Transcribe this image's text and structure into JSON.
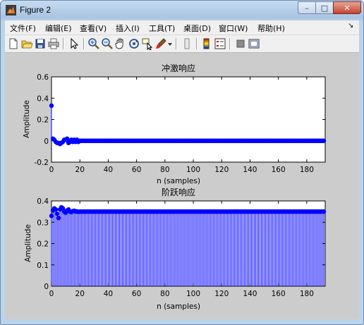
{
  "window": {
    "title": "Figure 2",
    "minimize_glyph": "–",
    "maximize_glyph": "□",
    "close_glyph": "✕"
  },
  "menubar": {
    "items": [
      "文件(F)",
      "编辑(E)",
      "查看(V)",
      "插入(I)",
      "工具(T)",
      "桌面(D)",
      "窗口(W)",
      "帮助(H)"
    ],
    "overflow_glyph": "↘"
  },
  "toolbar": {
    "buttons": [
      "new-figure-icon",
      "open-file-icon",
      "save-icon",
      "print-icon",
      "edit-plot-arrow-icon",
      "zoom-in-icon",
      "zoom-out-icon",
      "pan-hand-icon",
      "rotate-3d-icon",
      "data-cursor-icon",
      "brush-icon",
      "brush-dropdown-icon",
      "link-plot-icon",
      "insert-colorbar-icon",
      "insert-legend-icon",
      "hide-plot-tools-icon",
      "show-plot-tools-icon"
    ]
  },
  "colors": {
    "stem": "#0000ff",
    "axes_bg": "#ffffff",
    "figure_bg": "#cccccc"
  },
  "chart_data": [
    {
      "type": "scatter",
      "style": "stem",
      "title": "冲激响应",
      "xlabel": "n (samples)",
      "ylabel": "Amplitude",
      "xlim": [
        0,
        193
      ],
      "ylim": [
        -0.2,
        0.6
      ],
      "xticks": [
        0,
        20,
        40,
        60,
        80,
        100,
        120,
        140,
        160,
        180
      ],
      "yticks": [
        -0.2,
        0,
        0.2,
        0.4,
        0.6
      ],
      "xtick_labels": [
        "0",
        "20",
        "40",
        "60",
        "80",
        "100",
        "120",
        "140",
        "160",
        "180"
      ],
      "ytick_labels": [
        "-0.2",
        "0",
        "0.2",
        "0.4",
        "0.6"
      ],
      "grid": false,
      "n_points": 193,
      "head_values": [
        0.33,
        0.02,
        0.01,
        -0.01,
        -0.02,
        -0.02,
        -0.03,
        -0.02,
        -0.01,
        0.01,
        0.01,
        0.02,
        -0.02,
        -0.01,
        0.01,
        -0.01,
        0.01,
        -0.01,
        0.01,
        -0.01
      ],
      "tail_value": 0.0
    },
    {
      "type": "scatter",
      "style": "stem",
      "title": "阶跃响应",
      "xlabel": "n (samples)",
      "ylabel": "Amplitude",
      "xlim": [
        0,
        193
      ],
      "ylim": [
        0,
        0.4
      ],
      "xticks": [
        0,
        20,
        40,
        60,
        80,
        100,
        120,
        140,
        160,
        180
      ],
      "yticks": [
        0,
        0.1,
        0.2,
        0.3,
        0.4
      ],
      "xtick_labels": [
        "0",
        "20",
        "40",
        "60",
        "80",
        "100",
        "120",
        "140",
        "160",
        "180"
      ],
      "ytick_labels": [
        "0",
        "0.1",
        "0.2",
        "0.3",
        "0.4"
      ],
      "grid": false,
      "n_points": 193,
      "head_values": [
        0.33,
        0.355,
        0.365,
        0.36,
        0.34,
        0.32,
        0.36,
        0.37,
        0.365,
        0.35,
        0.345,
        0.355,
        0.36,
        0.35,
        0.348,
        0.352,
        0.354,
        0.35,
        0.351,
        0.349
      ],
      "tail_value": 0.35
    }
  ]
}
